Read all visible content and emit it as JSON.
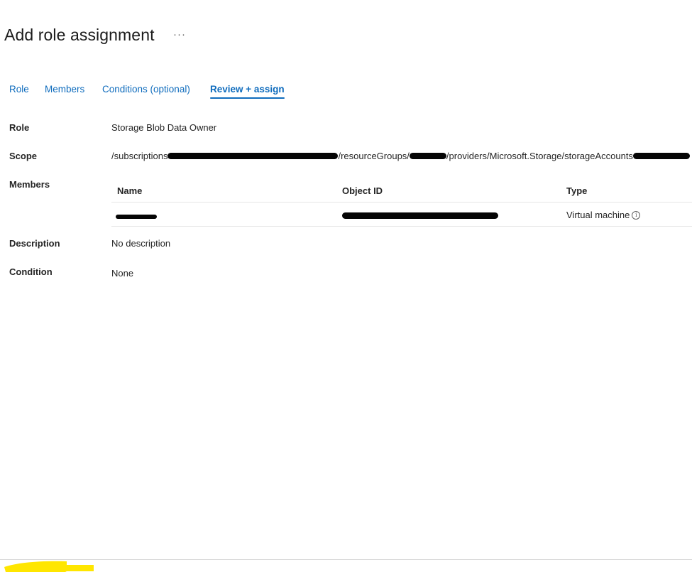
{
  "header": {
    "title": "Add role assignment",
    "more_label": "···"
  },
  "tabs": [
    {
      "label": "Role",
      "active": false
    },
    {
      "label": "Members",
      "active": false
    },
    {
      "label": "Conditions (optional)",
      "active": false
    },
    {
      "label": "Review + assign",
      "active": true
    }
  ],
  "review": {
    "role_label": "Role",
    "role_value": "Storage Blob Data Owner",
    "scope_label": "Scope",
    "scope_part1": "/subscriptions",
    "scope_part2": "/resourceGroups/",
    "scope_part3": "/providers/Microsoft.Storage/storageAccounts",
    "members_label": "Members",
    "description_label": "Description",
    "description_value": "No description",
    "condition_label": "Condition",
    "condition_value": "None"
  },
  "members_table": {
    "columns": [
      "Name",
      "Object ID",
      "Type"
    ],
    "rows": [
      {
        "name": "",
        "object_id": "",
        "type": "Virtual machine"
      }
    ]
  },
  "icons": {
    "info": "info-icon",
    "more": "more-horizontal-icon"
  },
  "colors": {
    "accent": "#0f6cbd",
    "redaction": "#050505",
    "highlight": "#ffe600"
  }
}
